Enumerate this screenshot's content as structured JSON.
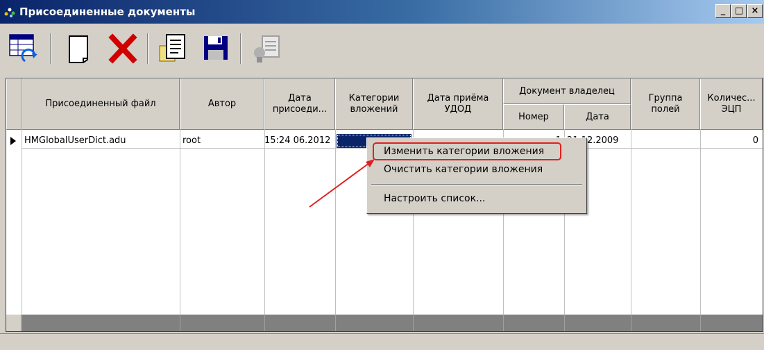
{
  "window": {
    "title": "Присоединенные документы",
    "controls": {
      "minimize": "_",
      "maximize": "□",
      "close": "×"
    }
  },
  "toolbar": {
    "buttons": [
      {
        "icon": "refresh-table-icon"
      },
      {
        "icon": "new-document-icon"
      },
      {
        "icon": "delete-icon",
        "color": "#d00000"
      },
      {
        "icon": "document-list-icon"
      },
      {
        "icon": "save-icon",
        "color": "#000080"
      },
      {
        "icon": "sign-document-icon",
        "state": "disabled"
      }
    ]
  },
  "table": {
    "columns": {
      "file": "Присоединенный файл",
      "author": "Автор",
      "date": "Дата\nприсоеди...",
      "category": "Категории\nвложений",
      "receive_date": "Дата приёма\nУДОД",
      "owner_group": "Документ владелец",
      "owner_number": "Номер",
      "owner_date": "Дата",
      "fields_group": "Группа\nполей",
      "signatures": "Количес...\nЭЦП"
    },
    "rows": [
      {
        "file": "HMGlobalUserDict.adu",
        "author": "root",
        "date": "06.2012 15:24",
        "category": "",
        "receive_date": "",
        "owner_number": "1",
        "owner_date": "21.12.2009",
        "fields_group": "",
        "signatures": "0"
      }
    ]
  },
  "context_menu": {
    "items": [
      {
        "label": "Изменить категории вложения",
        "highlighted": true
      },
      {
        "label": "Очистить категории вложения"
      },
      {
        "label": "Настроить список..."
      }
    ]
  },
  "colors": {
    "annotation_red": "#e02020",
    "selection": "#0a246a"
  }
}
